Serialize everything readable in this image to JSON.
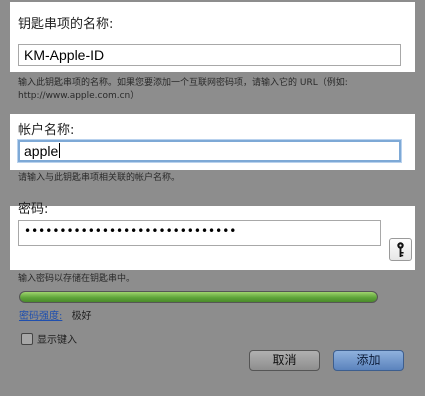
{
  "item_name": {
    "label": "钥匙串项的名称:",
    "value": "KM-Apple-ID",
    "help_line1": "输入此钥匙串项的名称。如果您要添加一个互联网密码项，请输入它的 URL（例如:",
    "help_line2": "http://www.apple.com.cn）"
  },
  "account_name": {
    "label": "帐户名称:",
    "value": "apple",
    "help": "请输入与此钥匙串项相关联的帐户名称。"
  },
  "password": {
    "label": "密码:",
    "masked_value": "••••••••••••••••••••••••••••••",
    "help": "输入密码以存储在钥匙串中。",
    "key_button_icon": "key-icon"
  },
  "strength": {
    "link_label": "密码强度:",
    "value_label": "极好",
    "fill_fraction": 1.0
  },
  "show_typing": {
    "label": "显示键入",
    "checked": false
  },
  "buttons": {
    "cancel": "取消",
    "add": "添加"
  }
}
